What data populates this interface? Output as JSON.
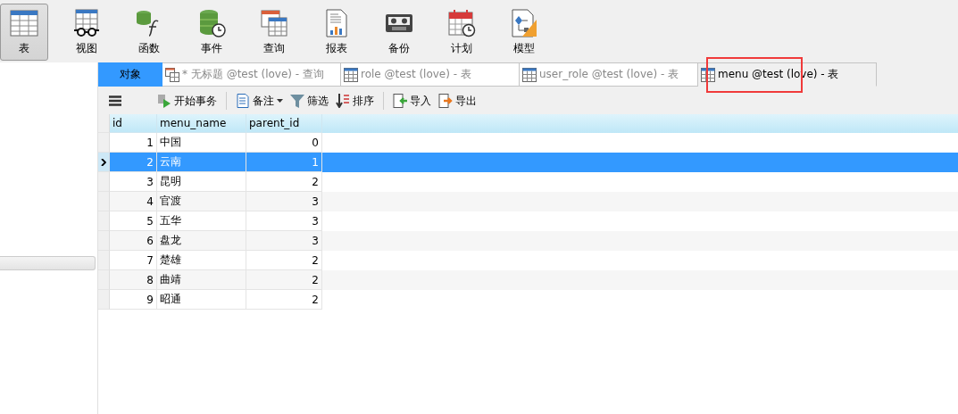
{
  "main_toolbar": [
    {
      "label": "表",
      "kind": "table",
      "selected": true
    },
    {
      "label": "视图",
      "kind": "view",
      "selected": false
    },
    {
      "label": "函数",
      "kind": "function",
      "selected": false
    },
    {
      "label": "事件",
      "kind": "event",
      "selected": false
    },
    {
      "label": "查询",
      "kind": "query",
      "selected": false
    },
    {
      "label": "报表",
      "kind": "report",
      "selected": false
    },
    {
      "label": "备份",
      "kind": "backup",
      "selected": false
    },
    {
      "label": "计划",
      "kind": "schedule",
      "selected": false
    },
    {
      "label": "模型",
      "kind": "model",
      "selected": false
    }
  ],
  "tabs": [
    {
      "kind": "objects",
      "label": "对象",
      "selected": false
    },
    {
      "kind": "query",
      "label": "* 无标题 @test (love) - 查询",
      "selected": false
    },
    {
      "kind": "table",
      "label": "role @test (love) - 表",
      "selected": false
    },
    {
      "kind": "table",
      "label": "user_role @test (love) - 表",
      "selected": false
    },
    {
      "kind": "table",
      "label": "menu @test (love) - 表",
      "selected": true,
      "highlighted": true
    }
  ],
  "actions": [
    {
      "kind": "menu"
    },
    {
      "kind": "transaction",
      "label": "开始事务"
    },
    {
      "kind": "separator"
    },
    {
      "kind": "note",
      "label": "备注"
    },
    {
      "kind": "filter",
      "label": "筛选"
    },
    {
      "kind": "sort",
      "label": "排序"
    },
    {
      "kind": "separator"
    },
    {
      "kind": "import",
      "label": "导入"
    },
    {
      "kind": "export",
      "label": "导出"
    }
  ],
  "table": {
    "columns": [
      "id",
      "menu_name",
      "parent_id"
    ],
    "rows": [
      {
        "cells": [
          "1",
          "中国",
          "0"
        ],
        "selected": false
      },
      {
        "cells": [
          "2",
          "云南",
          "1"
        ],
        "selected": true
      },
      {
        "cells": [
          "3",
          "昆明",
          "2"
        ],
        "selected": false
      },
      {
        "cells": [
          "4",
          "官渡",
          "3"
        ],
        "selected": false
      },
      {
        "cells": [
          "5",
          "五华",
          "3"
        ],
        "selected": false
      },
      {
        "cells": [
          "6",
          "盘龙",
          "3"
        ],
        "selected": false
      },
      {
        "cells": [
          "7",
          "楚雄",
          "2"
        ],
        "selected": false
      },
      {
        "cells": [
          "8",
          "曲靖",
          "2"
        ],
        "selected": false
      },
      {
        "cells": [
          "9",
          "昭通",
          "2"
        ],
        "selected": false
      }
    ]
  }
}
